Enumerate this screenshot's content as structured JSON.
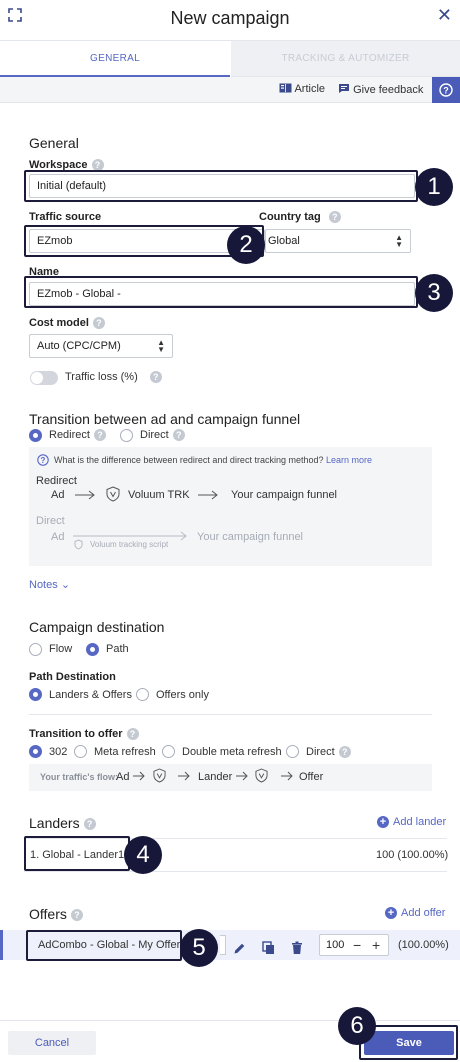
{
  "header": {
    "title": "New campaign",
    "expand_icon": "expand-icon",
    "close_icon": "close-icon"
  },
  "tabs": [
    {
      "label": "GENERAL",
      "active": true
    },
    {
      "label": "TRACKING & AUTOMIZER",
      "active": false
    }
  ],
  "helpbar": {
    "article": "Article",
    "feedback": "Give feedback",
    "help_icon": "question-icon"
  },
  "general": {
    "heading": "General",
    "workspace_label": "Workspace",
    "workspace_value": "Initial (default)",
    "traffic_source_label": "Traffic source",
    "traffic_source_value": "EZmob",
    "country_tag_label": "Country tag",
    "country_tag_value": "Global",
    "name_label": "Name",
    "name_value": "EZmob - Global -",
    "cost_model_label": "Cost model",
    "cost_model_value": "Auto (CPC/CPM)",
    "traffic_loss_label": "Traffic loss (%)",
    "traffic_loss_on": false
  },
  "transition": {
    "heading": "Transition between ad and campaign funnel",
    "options": [
      "Redirect",
      "Direct"
    ],
    "selected": "Redirect",
    "info_text": "What is the difference between redirect and direct tracking method?",
    "learn_more": "Learn more",
    "redirect_title": "Redirect",
    "redirect_ad": "Ad",
    "redirect_trk": "Voluum TRK",
    "redirect_funnel": "Your campaign funnel",
    "direct_title": "Direct",
    "direct_ad": "Ad",
    "direct_script": "Voluum tracking script",
    "direct_funnel": "Your campaign funnel",
    "notes": "Notes"
  },
  "destination": {
    "heading": "Campaign destination",
    "options": [
      "Flow",
      "Path"
    ],
    "selected": "Path",
    "path_dest_label": "Path Destination",
    "path_options": [
      "Landers & Offers",
      "Offers only"
    ],
    "path_selected": "Landers & Offers",
    "transition_offer_label": "Transition to offer",
    "transition_options": [
      "302",
      "Meta refresh",
      "Double meta refresh",
      "Direct"
    ],
    "transition_selected": "302",
    "flow_label": "Your traffic's flow:",
    "flow_ad": "Ad",
    "flow_lander": "Lander",
    "flow_offer": "Offer"
  },
  "landers": {
    "heading": "Landers",
    "add_label": "Add lander",
    "rows": [
      {
        "name": "1. Global - Lander1",
        "weight": "100 (100.00%)"
      }
    ]
  },
  "offers": {
    "heading": "Offers",
    "add_label": "Add offer",
    "rows": [
      {
        "name": "AdCombo - Global - My Offer",
        "weight_value": "100",
        "percent": "(100.00%)"
      }
    ]
  },
  "footer": {
    "cancel": "Cancel",
    "save": "Save"
  },
  "callouts": [
    "1",
    "2",
    "3",
    "4",
    "5",
    "6"
  ],
  "colors": {
    "accent": "#5667c4",
    "primary_button": "#4b5bb8",
    "callout": "#17173a"
  }
}
